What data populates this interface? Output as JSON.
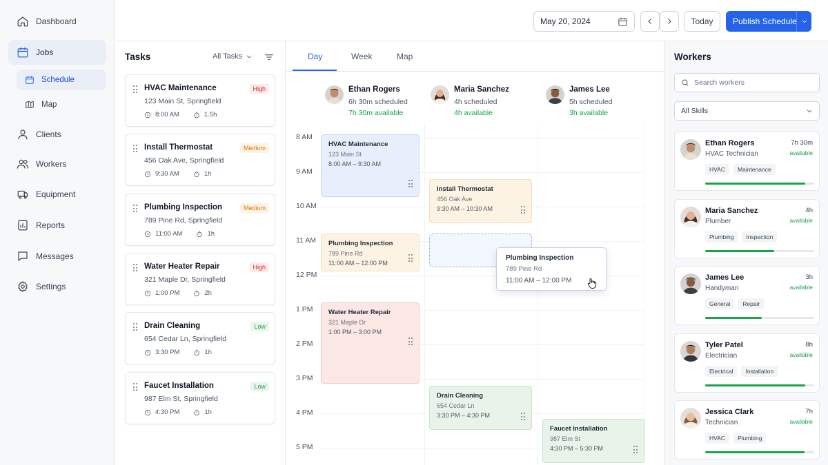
{
  "sidebar": {
    "items": [
      {
        "label": "Dashboard",
        "icon": "home-icon"
      },
      {
        "label": "Jobs",
        "icon": "calendar-icon"
      },
      {
        "label": "Schedule",
        "icon": "calendar-icon"
      },
      {
        "label": "Map",
        "icon": "map-icon"
      },
      {
        "label": "Clients",
        "icon": "user-icon"
      },
      {
        "label": "Workers",
        "icon": "users-icon"
      },
      {
        "label": "Equipment",
        "icon": "truck-icon"
      },
      {
        "label": "Reports",
        "icon": "report-icon"
      },
      {
        "label": "Messages",
        "icon": "message-icon"
      },
      {
        "label": "Settings",
        "icon": "gear-icon"
      }
    ]
  },
  "topbar": {
    "date": "May 20, 2024",
    "today_label": "Today",
    "publish_label": "Publish Schedule"
  },
  "tasks": {
    "title": "Tasks",
    "filter_label": "All Tasks",
    "items": [
      {
        "name": "HVAC Maintenance",
        "address": "123 Main St, Springfield",
        "time": "8:00 AM",
        "duration": "1.5h",
        "priority": "High"
      },
      {
        "name": "Install Thermostat",
        "address": "456 Oak Ave, Springfield",
        "time": "9:30 AM",
        "duration": "1h",
        "priority": "Medium"
      },
      {
        "name": "Plumbing Inspection",
        "address": "789 Pine Rd, Springfield",
        "time": "11:00 AM",
        "duration": "1h",
        "priority": "Medium"
      },
      {
        "name": "Water Heater Repair",
        "address": "321 Maple Dr, Springfield",
        "time": "1:00 PM",
        "duration": "2h",
        "priority": "High"
      },
      {
        "name": "Drain Cleaning",
        "address": "654 Cedar Ln, Springfield",
        "time": "3:30 PM",
        "duration": "1h",
        "priority": "Low"
      },
      {
        "name": "Faucet Installation",
        "address": "987 Elm St, Springfield",
        "time": "4:30 PM",
        "duration": "1h",
        "priority": "Low"
      }
    ]
  },
  "priority_colors": {
    "High": {
      "bg": "#fdecec",
      "fg": "#dc2626"
    },
    "Medium": {
      "bg": "#fdf3e2",
      "fg": "#d97706"
    },
    "Low": {
      "bg": "#e8f6ec",
      "fg": "#16a34a"
    }
  },
  "calendar": {
    "tabs": [
      "Day",
      "Week",
      "Map"
    ],
    "active_tab": "Day",
    "hours": [
      "8 AM",
      "9 AM",
      "10 AM",
      "11 AM",
      "12 PM",
      "1 PM",
      "2 PM",
      "3 PM",
      "4 PM",
      "5 PM"
    ],
    "workers": [
      {
        "name": "Ethan Rogers",
        "scheduled": "6h 30m scheduled",
        "available": "7h 30m available"
      },
      {
        "name": "Maria Sanchez",
        "scheduled": "4h scheduled",
        "available": "4h available"
      },
      {
        "name": "James Lee",
        "scheduled": "5h scheduled",
        "available": "3h available"
      }
    ],
    "events": [
      {
        "title": "HVAC Maintenance",
        "address": "123 Main St",
        "time": "8:00 AM – 9:30 AM"
      },
      {
        "title": "Install Thermostat",
        "address": "456 Oak Ave",
        "time": "9:30 AM – 10:30 AM"
      },
      {
        "title": "Plumbing Inspection",
        "address": "789 Pine Rd",
        "time": "11:00 AM – 12:00 PM"
      },
      {
        "title": "Water Heater Repair",
        "address": "321 Maple Dr",
        "time": "1:00 PM – 3:00 PM"
      },
      {
        "title": "Drain Cleaning",
        "address": "654 Cedar Ln",
        "time": "3:30 PM – 4:30 PM"
      },
      {
        "title": "Faucet Installation",
        "address": "987 Elm St",
        "time": "4:30 PM – 5:30 PM"
      }
    ],
    "drag_preview": {
      "title": "Plumbing Inspection",
      "address": "789 Pine Rd",
      "time": "11:00 AM – 12:00 PM"
    }
  },
  "workers_panel": {
    "title": "Workers",
    "search_placeholder": "Search workers",
    "skills_filter": "All Skills",
    "items": [
      {
        "name": "Ethan Rogers",
        "role": "HVAC Technician",
        "hours": "7h 30m",
        "available": "available",
        "tags": [
          "HVAC",
          "Maintenance"
        ],
        "utilization": 0.92
      },
      {
        "name": "Maria Sanchez",
        "role": "Plumber",
        "hours": "4h",
        "available": "available",
        "tags": [
          "Plumbing",
          "Inspection"
        ],
        "utilization": 0.63
      },
      {
        "name": "James Lee",
        "role": "Handyman",
        "hours": "3h",
        "available": "available",
        "tags": [
          "General",
          "Repair"
        ],
        "utilization": 0.52
      },
      {
        "name": "Tyler Patel",
        "role": "Electrician",
        "hours": "8h",
        "available": "available",
        "tags": [
          "Electrical",
          "Installation"
        ],
        "utilization": 0.92
      },
      {
        "name": "Jessica Clark",
        "role": "Technician",
        "hours": "7h",
        "available": "available",
        "tags": [
          "HVAC",
          "Plumbing"
        ],
        "utilization": 0.91
      }
    ]
  },
  "colors": {
    "accent": "#2563eb",
    "available": "#16a34a"
  }
}
